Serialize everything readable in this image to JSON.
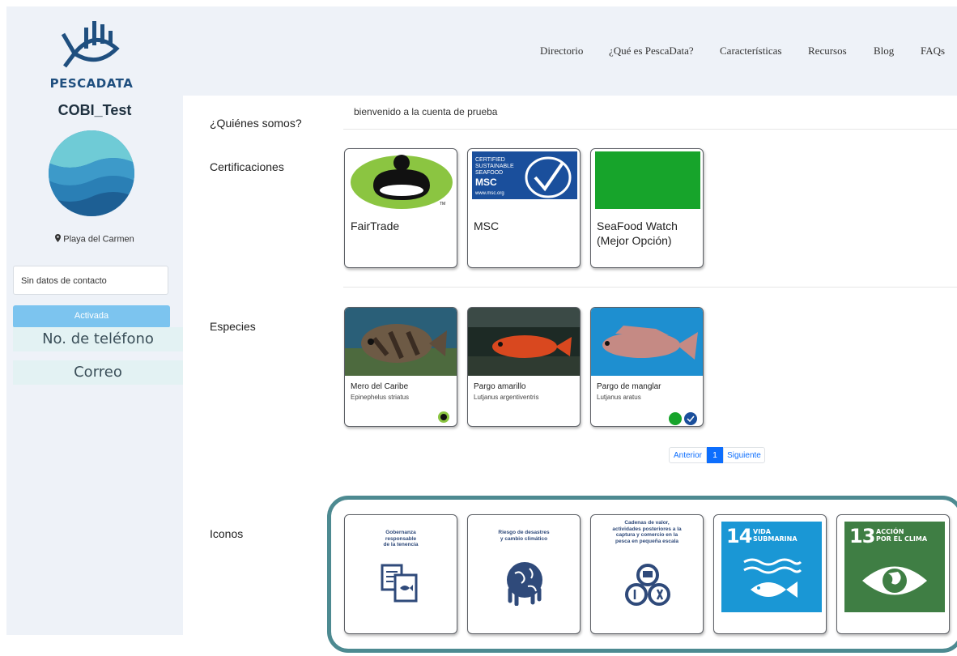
{
  "brand": {
    "logo_text": "PESCADATA"
  },
  "nav": {
    "items": [
      "Directorio",
      "¿Qué es PescaData?",
      "Características",
      "Recursos",
      "Blog",
      "FAQs"
    ]
  },
  "profile": {
    "username": "COBI_Test",
    "location": "Playa del Carmen",
    "contact_box": "Sin datos de contacto",
    "status_button": "Activada",
    "phone_label": "No. de teléfono",
    "email_label": "Correo"
  },
  "about": {
    "heading": "¿Quiénes somos?",
    "text": "bienvenido a la cuenta de prueba"
  },
  "certifications": {
    "heading": "Certificaciones",
    "items": [
      {
        "label": "FairTrade"
      },
      {
        "label": "MSC",
        "logo_lines": [
          "CERTIFIED",
          "SUSTAINABLE",
          "SEAFOOD",
          "MSC",
          "www.msc.org"
        ]
      },
      {
        "label_line1": "SeaFood Watch",
        "label_line2": "(Mejor Opción)",
        "color": "#17a42b"
      }
    ]
  },
  "species": {
    "heading": "Especies",
    "items": [
      {
        "name": "Mero del Caribe",
        "scientific": "Epinephelus striatus"
      },
      {
        "name": "Pargo amarillo",
        "scientific": "Lutjanus argentiventris"
      },
      {
        "name": "Pargo de manglar",
        "scientific": "Lutjanus aratus"
      }
    ],
    "pagination": {
      "prev": "Anterior",
      "current": "1",
      "next": "Siguiente"
    }
  },
  "icons": {
    "heading": "Iconos",
    "items": [
      {
        "lines": [
          "Gobernanza",
          "responsable",
          "de la tenencia"
        ],
        "icon": "documents-fish-icon"
      },
      {
        "lines": [
          "Riesgo de desastres",
          "y cambio climático"
        ],
        "icon": "globe-melting-icon"
      },
      {
        "lines": [
          "Cadenas de valor,",
          "actividades posteriores a la",
          "captura y comercio en la",
          "pesca en pequeña escala"
        ],
        "icon": "value-chain-icon"
      },
      {
        "number": "14",
        "title_line1": "VIDA",
        "title_line2": "SUBMARINA",
        "color": "#1a97d5",
        "icon": "fish-waves-icon"
      },
      {
        "number": "13",
        "title_line1": "ACCIÓN",
        "title_line2": "POR EL CLIMA",
        "color": "#3f7e44",
        "icon": "eye-globe-icon"
      }
    ]
  },
  "colors": {
    "accent": "#1f4f7f",
    "frame": "#4d8a91",
    "button": "#7cc4ef",
    "pager_active": "#0d6efd"
  }
}
